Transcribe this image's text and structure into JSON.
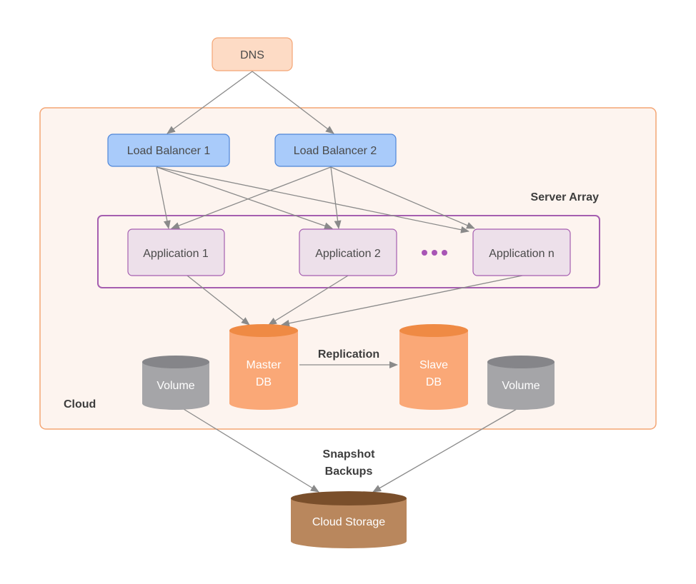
{
  "colors": {
    "cloud_fill": "#fdf4ef",
    "cloud_stroke": "#f4a574",
    "dns_fill": "#fddbc5",
    "dns_stroke": "#f4a574",
    "lb_fill": "#a9cbfa",
    "lb_stroke": "#4f86d8",
    "server_array_stroke": "#a55eb0",
    "app_fill": "#ede0ea",
    "app_stroke": "#a55eb0",
    "dots": "#a855b5",
    "db_body": "#faa877",
    "db_top": "#ef8a44",
    "volume_body": "#a5a5a8",
    "volume_top": "#858589",
    "storage_body": "#b9875d",
    "storage_top": "#7a4f2b",
    "edge": "#8a8a8a"
  },
  "dns": {
    "label": "DNS"
  },
  "cloud": {
    "label": "Cloud"
  },
  "server_array": {
    "label": "Server Array"
  },
  "load_balancers": [
    {
      "label": "Load Balancer 1"
    },
    {
      "label": "Load Balancer 2"
    }
  ],
  "applications": [
    {
      "label": "Application 1"
    },
    {
      "label": "Application 2"
    },
    {
      "label": "Application n"
    }
  ],
  "ellipsis": "•••",
  "master_db": {
    "line1": "Master",
    "line2": "DB"
  },
  "slave_db": {
    "line1": "Slave",
    "line2": "DB"
  },
  "replication": {
    "label": "Replication"
  },
  "volumes": [
    {
      "label": "Volume"
    },
    {
      "label": "Volume"
    }
  ],
  "snapshot": {
    "line1": "Snapshot",
    "line2": "Backups"
  },
  "cloud_storage": {
    "label": "Cloud Storage"
  }
}
